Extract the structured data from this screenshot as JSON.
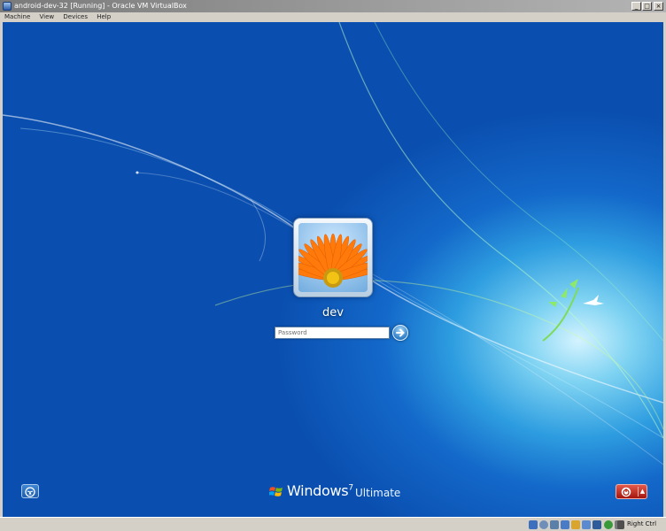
{
  "window": {
    "title": "android-dev-32 [Running] - Oracle VM VirtualBox",
    "controls": {
      "minimize": "_",
      "maximize": "□",
      "close": "×"
    }
  },
  "menubar": {
    "items": [
      "Machine",
      "View",
      "Devices",
      "Help"
    ]
  },
  "login": {
    "username": "dev",
    "password_placeholder": "Password",
    "submit_icon": "arrow-right-icon",
    "user_picture": "orange-flower"
  },
  "branding": {
    "word": "Windows",
    "version": "7",
    "edition": "Ultimate"
  },
  "bottom": {
    "ease_of_access_icon": "ease-of-access-icon",
    "power_icon": "power-icon",
    "power_menu_arrow": "▲"
  },
  "statusbar": {
    "icons": [
      "hard-disk-icon",
      "optical-drive-icon",
      "floppy-icon",
      "usb-icon",
      "shared-folder-icon",
      "network-icon",
      "display-icon",
      "capture-icon",
      "mouse-integration-icon",
      "keyboard-icon"
    ],
    "host_key": "Right Ctrl"
  },
  "colors": {
    "accent": "#1368c9",
    "power": "#c22a1c",
    "titlebar": "#8a8a8a"
  }
}
